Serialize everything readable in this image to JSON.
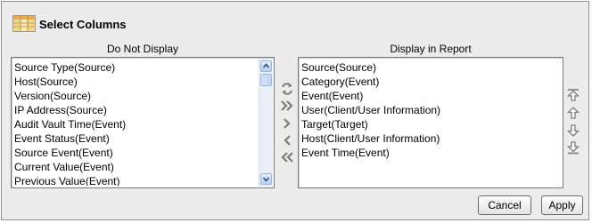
{
  "title": "Select Columns",
  "left_list": {
    "label": "Do Not Display",
    "items": [
      "Source Type(Source)",
      "Host(Source)",
      "Version(Source)",
      "IP Address(Source)",
      "Audit Vault Time(Event)",
      "Event Status(Event)",
      "Source Event(Event)",
      "Current Value(Event)",
      "Previous Value(Event)"
    ]
  },
  "right_list": {
    "label": "Display in Report",
    "items": [
      "Source(Source)",
      "Category(Event)",
      "Event(Event)",
      "User(Client/User Information)",
      "Target(Target)",
      "Host(Client/User Information)",
      "Event Time(Event)"
    ]
  },
  "buttons": {
    "cancel": "Cancel",
    "apply": "Apply"
  },
  "icons": {
    "title": "table-columns-icon",
    "move_transfer": "swap-icon",
    "move_all_right": "double-chevron-right-icon",
    "move_right": "chevron-right-icon",
    "move_left": "chevron-left-icon",
    "move_all_left": "double-chevron-left-icon",
    "move_top": "move-top-icon",
    "move_up": "move-up-icon",
    "move_down": "move-down-icon",
    "move_bottom": "move-bottom-icon"
  },
  "colors": {
    "dialog_bg": "#ececec",
    "icon_gray": "#7c7c7c",
    "scroll_blue": "#b9cdee"
  }
}
